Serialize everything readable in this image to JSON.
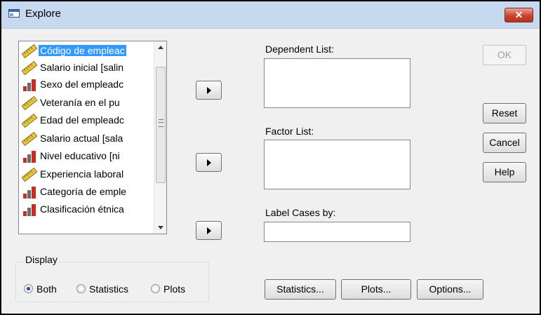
{
  "window": {
    "title": "Explore",
    "close_label": "✕"
  },
  "variables": [
    {
      "label": "Código de empleac",
      "type": "scale",
      "selected": true
    },
    {
      "label": "Salario inicial [salin",
      "type": "scale"
    },
    {
      "label": "Sexo del empleadc",
      "type": "nominal"
    },
    {
      "label": "Veteranía en el pu",
      "type": "scale"
    },
    {
      "label": "Edad del empleadc",
      "type": "scale"
    },
    {
      "label": "Salario actual [sala",
      "type": "scale"
    },
    {
      "label": "Nivel educativo [ni",
      "type": "nominal"
    },
    {
      "label": "Experiencia laboral",
      "type": "scale"
    },
    {
      "label": "Categoría de emple",
      "type": "nominal"
    },
    {
      "label": "Clasificación étnica",
      "type": "nominal"
    }
  ],
  "labels": {
    "dependent_list": "Dependent List:",
    "factor_list": "Factor List:",
    "label_cases_by": "Label Cases by:"
  },
  "buttons": {
    "ok": "OK",
    "reset": "Reset",
    "cancel": "Cancel",
    "help": "Help",
    "statistics": "Statistics...",
    "plots": "Plots...",
    "options": "Options..."
  },
  "display": {
    "legend": "Display",
    "options": [
      "Both",
      "Statistics",
      "Plots"
    ],
    "selected": "Both"
  },
  "colors": {
    "title_bar": "#c7d9ef",
    "selection": "#3399ff",
    "close_button": "#c8432e"
  }
}
